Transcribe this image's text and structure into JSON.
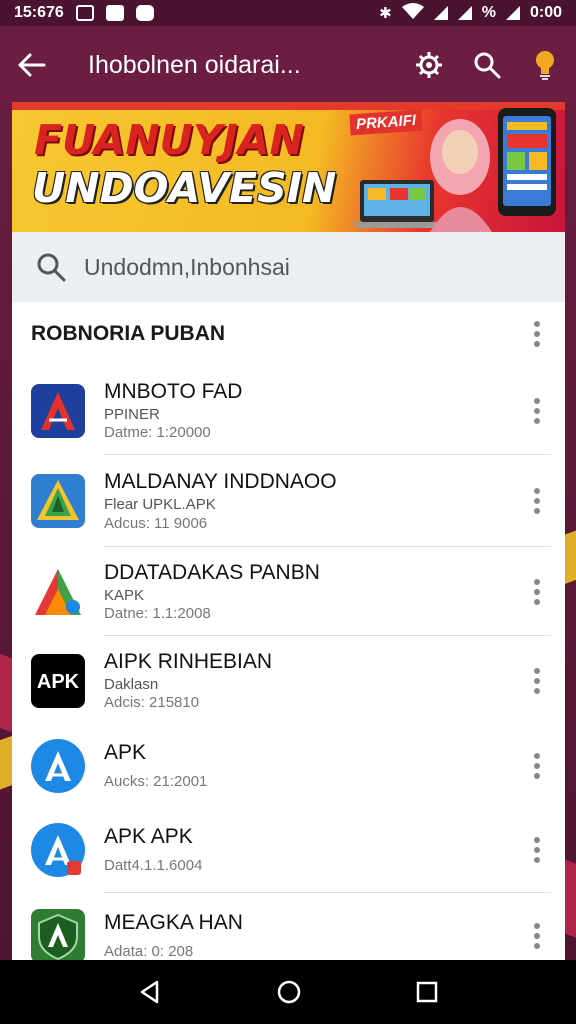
{
  "status_bar": {
    "time": "15:676",
    "right_text": "0:00",
    "battery_label": "%"
  },
  "app_bar": {
    "title": "Ihobolnen oidarai...",
    "icons": [
      "back-arrow-icon",
      "settings-icon",
      "search-icon",
      "lightbulb-icon"
    ]
  },
  "banner": {
    "line1": "FUANUYJAN",
    "line2": "UNDOAVESIN",
    "tag": "PRKAIFI"
  },
  "search": {
    "placeholder": "Undodmn,Inbonhsai"
  },
  "section": {
    "title": "ROBNORIA PUBAN"
  },
  "items": [
    {
      "title": "MNBOTO FAD",
      "subtitle": "PPINER",
      "meta": "Datme: 1:20000",
      "icon": "red-a-icon"
    },
    {
      "title": "MALDANAY INDDNAOO",
      "subtitle": "Flear UPKL.APK",
      "meta": "Adcus: 11 9006",
      "icon": "green-triangle-icon"
    },
    {
      "title": "DDATADAKAS PANBN",
      "subtitle": "KAPK",
      "meta": "Datne: 1.1:2008",
      "icon": "multicolor-a-icon"
    },
    {
      "title": "AIPK RINHEBIAN",
      "subtitle": "Daklasn",
      "meta": "Adcis: 215810",
      "icon": "apk-icon"
    },
    {
      "title": "APK",
      "subtitle": "",
      "meta": "Aucks: 21:2001",
      "icon": "blue-a-icon"
    },
    {
      "title": "APK  APK",
      "subtitle": "",
      "meta": "Datt4.1.1.6004",
      "icon": "blue-a-badge-icon"
    },
    {
      "title": "MEAGKA HAN",
      "subtitle": "",
      "meta": "Adata: 0: 208",
      "icon": "green-shield-icon"
    }
  ],
  "colors": {
    "app_bar": "#6b1e42",
    "status_bar": "#4a1330",
    "banner_yellow": "#f4b923",
    "banner_red": "#d9231f"
  }
}
